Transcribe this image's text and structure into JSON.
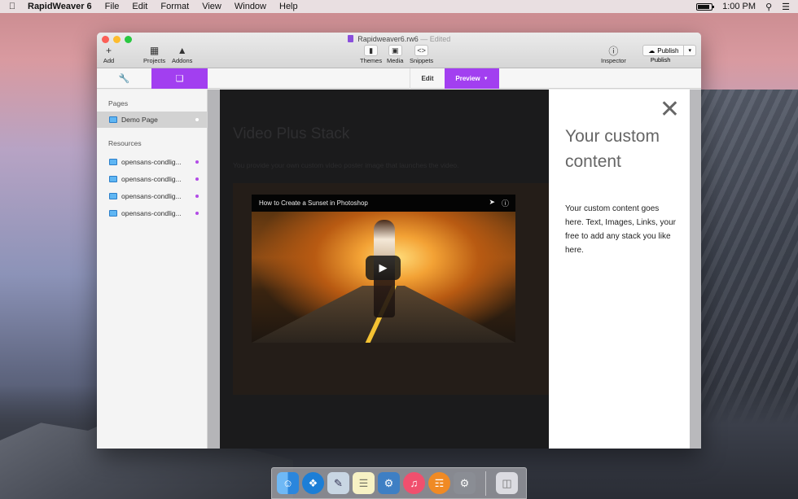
{
  "menubar": {
    "app_name": "RapidWeaver 6",
    "menus": [
      "File",
      "Edit",
      "Format",
      "View",
      "Window",
      "Help"
    ],
    "clock": "1:00 PM"
  },
  "window": {
    "filename": "Rapidweaver6.rw6",
    "separator": "—",
    "status": "Edited"
  },
  "toolbar": {
    "add": "Add",
    "projects": "Projects",
    "addons": "Addons",
    "themes": "Themes",
    "media": "Media",
    "snippets": "Snippets",
    "inspector": "Inspector",
    "publish_button": "Publish",
    "publish_label": "Publish"
  },
  "tabs": {
    "edit": "Edit",
    "preview": "Preview"
  },
  "sidebar": {
    "pages_heading": "Pages",
    "pages": [
      {
        "label": "Demo Page"
      }
    ],
    "resources_heading": "Resources",
    "resources": [
      {
        "label": "opensans-condlig..."
      },
      {
        "label": "opensans-condlig..."
      },
      {
        "label": "opensans-condlig..."
      },
      {
        "label": "opensans-condlig..."
      }
    ]
  },
  "preview": {
    "heading": "Video Plus Stack",
    "description": "You provide your own custom video poster image that launches the video.",
    "video_title": "How to Create a Sunset in Photoshop"
  },
  "panel": {
    "close_glyph": "✕",
    "heading": "Your custom content",
    "text": "Your custom content goes here. Text, Images, Links, your free to add any stack you like here."
  },
  "colors": {
    "accent": "#a23ff0",
    "resource_dot": "#b24be6"
  },
  "dock": {
    "icons": [
      "finder-icon",
      "safari-icon",
      "preview-icon",
      "notes-icon",
      "xcode-icon",
      "itunes-icon",
      "ibooks-icon",
      "system-preferences-icon",
      "trash-icon"
    ]
  }
}
